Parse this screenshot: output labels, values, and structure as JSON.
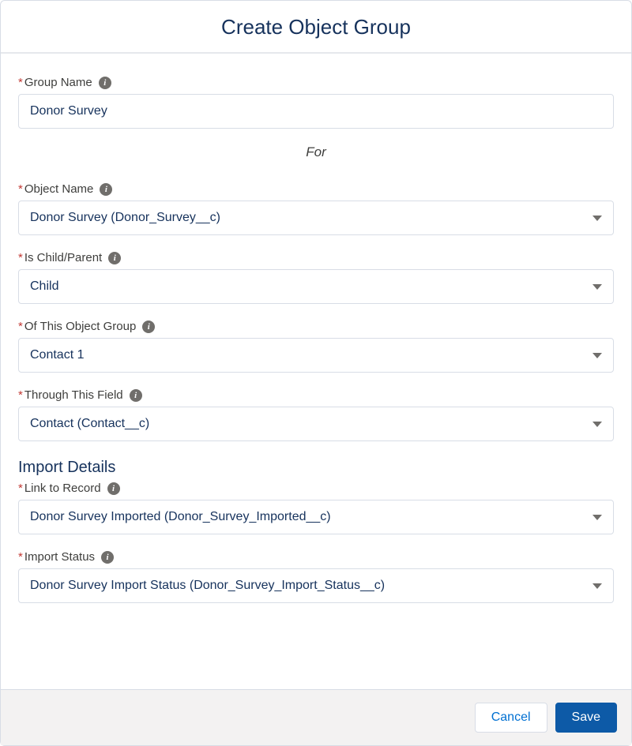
{
  "header": {
    "title": "Create Object Group"
  },
  "fields": {
    "group_name": {
      "label": "Group Name",
      "value": "Donor Survey"
    },
    "for_label": "For",
    "object_name": {
      "label": "Object Name",
      "value": "Donor Survey (Donor_Survey__c)"
    },
    "is_child_parent": {
      "label": "Is Child/Parent",
      "value": "Child"
    },
    "of_this_object_group": {
      "label": "Of This Object Group",
      "value": "Contact 1"
    },
    "through_this_field": {
      "label": "Through This Field",
      "value": "Contact (Contact__c)"
    }
  },
  "import_details": {
    "heading": "Import Details",
    "link_to_record": {
      "label": "Link to Record",
      "value": "Donor Survey Imported (Donor_Survey_Imported__c)"
    },
    "import_status": {
      "label": "Import Status",
      "value": "Donor Survey Import Status (Donor_Survey_Import_Status__c)"
    }
  },
  "footer": {
    "cancel_label": "Cancel",
    "save_label": "Save"
  }
}
